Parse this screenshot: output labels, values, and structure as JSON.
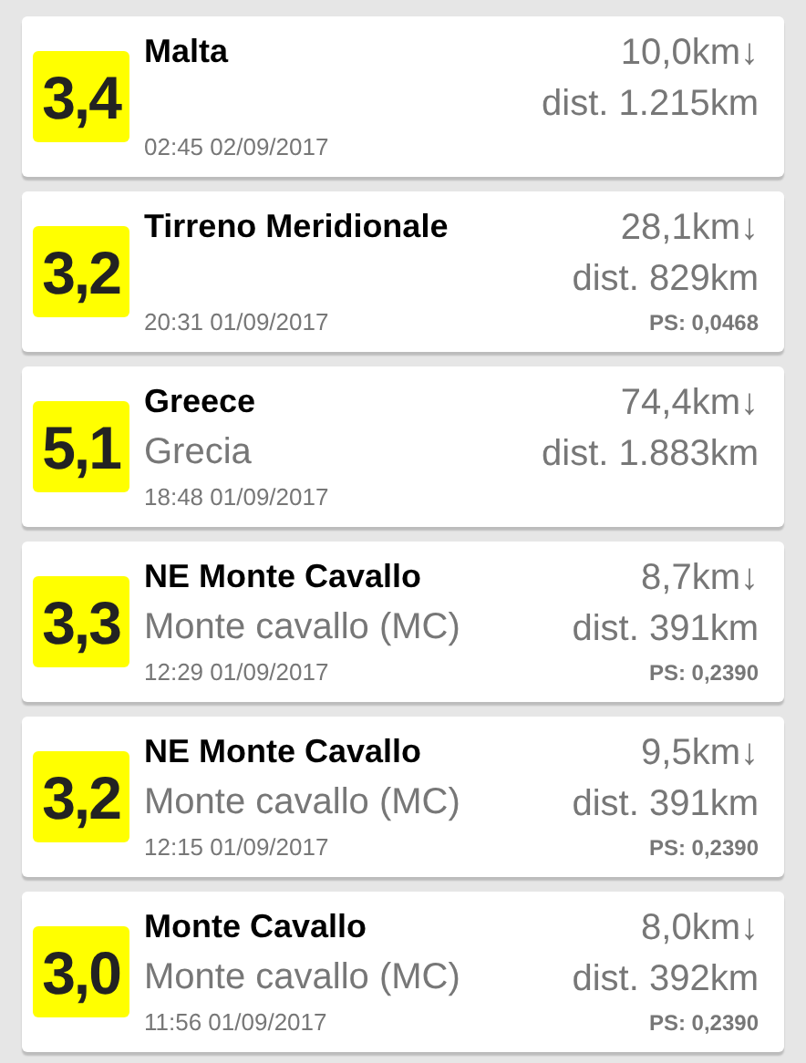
{
  "events": [
    {
      "magnitude": "3,4",
      "title": "Malta",
      "time": "02:45 02/09/2017",
      "depth": "10,0km↓",
      "distance": "dist. 1.215km"
    },
    {
      "magnitude": "3,2",
      "title": "Tirreno Meridionale",
      "time": "20:31 01/09/2017",
      "depth": "28,1km↓",
      "distance": "dist. 829km",
      "ps": "PS: 0,0468"
    },
    {
      "magnitude": "5,1",
      "title": "Greece",
      "region": "Grecia",
      "time": "18:48 01/09/2017",
      "depth": "74,4km↓",
      "distance": "dist. 1.883km"
    },
    {
      "magnitude": "3,3",
      "title": "NE Monte Cavallo",
      "region": "Monte cavallo (MC)",
      "time": "12:29 01/09/2017",
      "depth": "8,7km↓",
      "distance": "dist. 391km",
      "ps": "PS: 0,2390"
    },
    {
      "magnitude": "3,2",
      "title": "NE Monte Cavallo",
      "region": "Monte cavallo (MC)",
      "time": "12:15 01/09/2017",
      "depth": "9,5km↓",
      "distance": "dist. 391km",
      "ps": "PS: 0,2390"
    },
    {
      "magnitude": "3,0",
      "title": "Monte Cavallo",
      "region": "Monte cavallo (MC)",
      "time": "11:56 01/09/2017",
      "depth": "8,0km↓",
      "distance": "dist. 392km",
      "ps": "PS: 0,2390"
    }
  ]
}
